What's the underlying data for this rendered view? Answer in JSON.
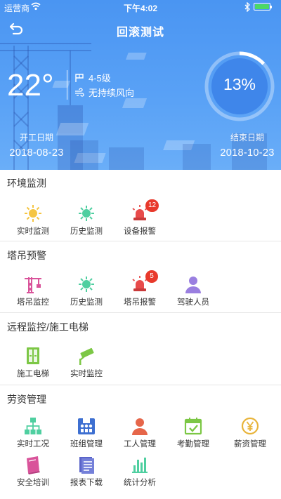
{
  "status_bar": {
    "carrier": "运营商",
    "time": "下午4:02"
  },
  "nav": {
    "title": "回滚测试"
  },
  "weather": {
    "temperature": "22°",
    "wind_level": "4-5级",
    "wind_direction": "无持续风向"
  },
  "progress": {
    "label": "13%",
    "value": 0.13
  },
  "dates": {
    "start_label": "开工日期",
    "start_date": "2018-08-23",
    "end_label": "结束日期",
    "end_date": "2018-10-23"
  },
  "sections": {
    "env": {
      "title": "环境监测",
      "items": [
        {
          "label": "实时监测",
          "icon": "sun-icon"
        },
        {
          "label": "历史监测",
          "icon": "history-sun-icon"
        },
        {
          "label": "设备报警",
          "icon": "alarm-icon",
          "badge": "12"
        }
      ]
    },
    "crane": {
      "title": "塔吊预警",
      "items": [
        {
          "label": "塔吊监控",
          "icon": "tower-crane-icon"
        },
        {
          "label": "历史监测",
          "icon": "history-sun-icon"
        },
        {
          "label": "塔吊报警",
          "icon": "alarm-icon",
          "badge": "5"
        },
        {
          "label": "驾驶人员",
          "icon": "driver-icon"
        }
      ]
    },
    "remote": {
      "title": "远程监控/施工电梯",
      "items": [
        {
          "label": "施工电梯",
          "icon": "elevator-icon"
        },
        {
          "label": "实时监控",
          "icon": "camera-icon"
        }
      ]
    },
    "labor": {
      "title": "劳资管理",
      "items": [
        {
          "label": "实时工况",
          "icon": "org-chart-icon"
        },
        {
          "label": "班组管理",
          "icon": "team-icon"
        },
        {
          "label": "工人管理",
          "icon": "worker-icon"
        },
        {
          "label": "考勤管理",
          "icon": "attendance-icon"
        },
        {
          "label": "薪资管理",
          "icon": "salary-icon"
        },
        {
          "label": "安全培训",
          "icon": "book-icon"
        },
        {
          "label": "报表下载",
          "icon": "report-icon"
        },
        {
          "label": "统计分析",
          "icon": "bar-chart-icon"
        }
      ]
    }
  },
  "colors": {
    "header": "#4f9af4",
    "badge": "#e8392b",
    "sun": "#f5c542",
    "teal": "#4fcfa0",
    "alarm": "#e84b4b",
    "crane": "#d9539a",
    "purple": "#9a7fe0",
    "green": "#7cc745",
    "blue": "#3d6fd1",
    "orange": "#e6664a"
  }
}
